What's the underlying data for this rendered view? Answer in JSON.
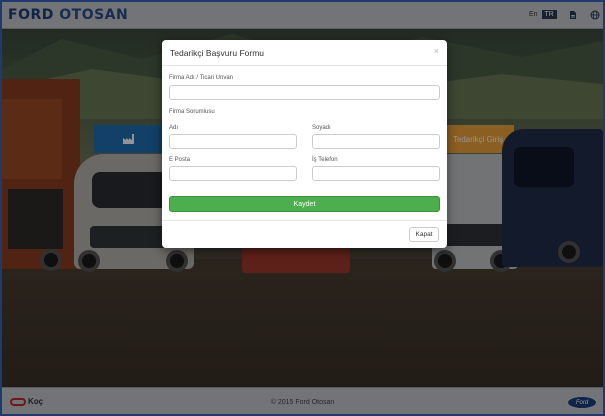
{
  "header": {
    "logo_part1": "FORD",
    "logo_part2": "OTOSAN",
    "lang_en": "En",
    "lang_tr": "TR",
    "icons": [
      "document-icon",
      "globe-icon"
    ]
  },
  "background": {
    "left_button": "",
    "right_button": "Tedarikçi Giriş"
  },
  "modal": {
    "title": "Tedarikçi Başvuru Formu",
    "close_symbol": "×",
    "company_name_label": "Firma Adı / Ticari Unvan",
    "company_name_value": "",
    "responsible_section_label": "Firma Sorumlusu",
    "first_name_label": "Adı",
    "last_name_label": "Soyadı",
    "email_label": "E Posta",
    "phone_label": "İş Telefon",
    "save_label": "Kaydet",
    "close_label": "Kapat"
  },
  "footer": {
    "koc_label": "Koç",
    "copyright": "© 2015 Ford Otosan",
    "ford_badge": "Ford"
  },
  "colors": {
    "brand_blue": "#1d3f79",
    "save_green": "#4cae4c",
    "accent_orange": "#f0a23a"
  }
}
